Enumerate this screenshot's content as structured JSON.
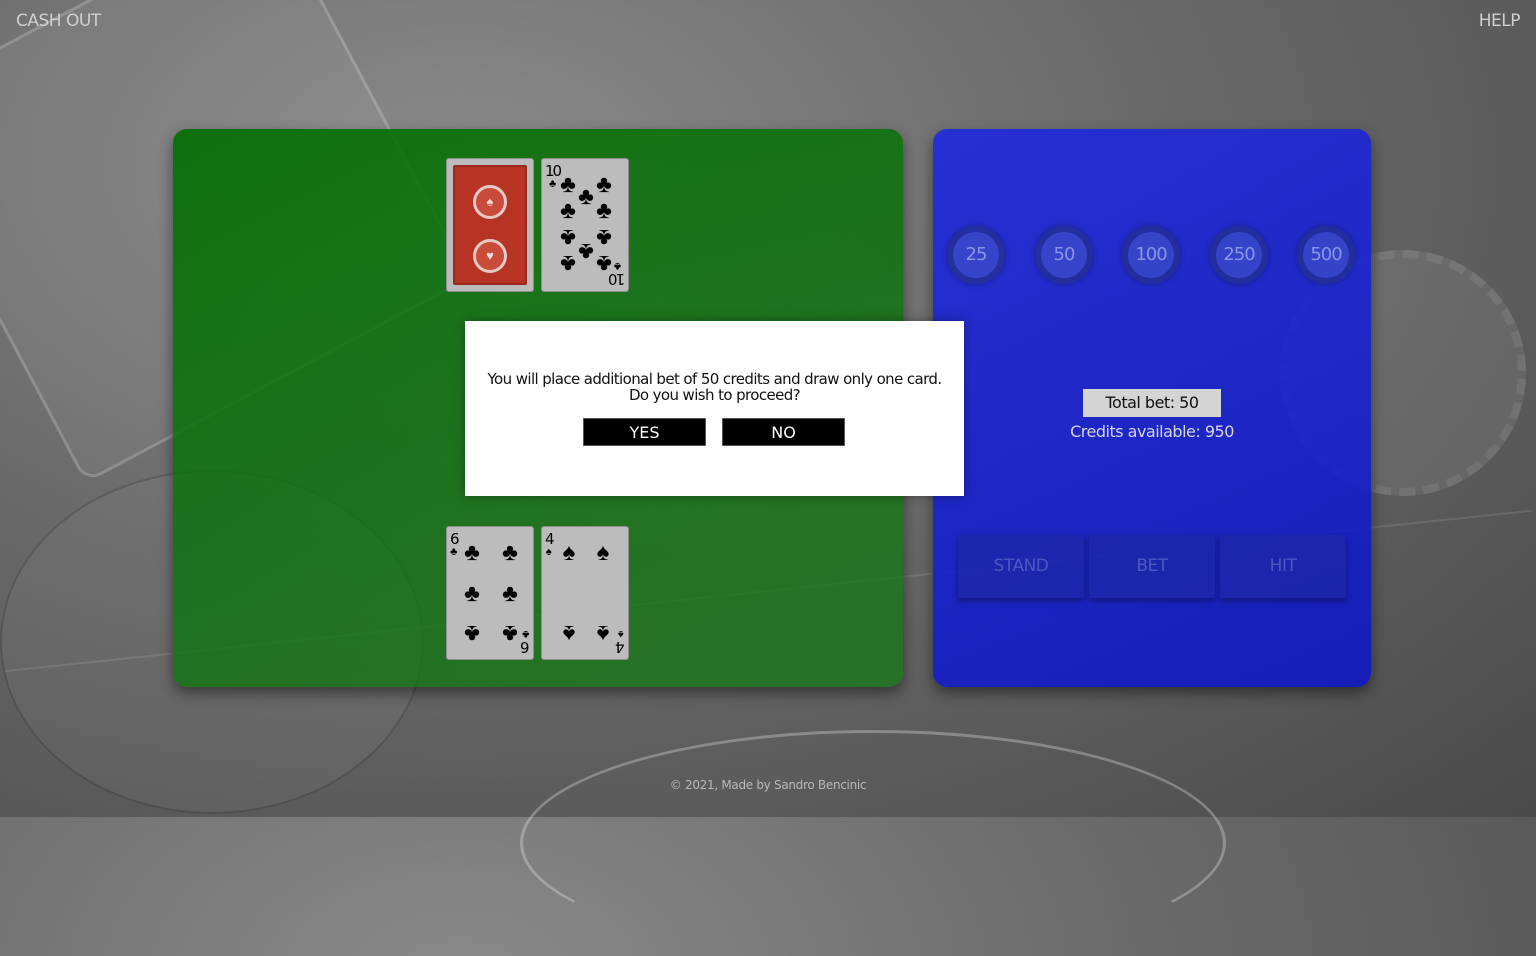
{
  "nav": {
    "cash_out": "CASH OUT",
    "help": "HELP"
  },
  "dealer_hand": [
    {
      "face_down": true
    },
    {
      "rank": "10",
      "suit": "♣"
    }
  ],
  "player_hand": [
    {
      "rank": "6",
      "suit": "♣"
    },
    {
      "rank": "4",
      "suit": "♠"
    }
  ],
  "chips": [
    "25",
    "50",
    "100",
    "250",
    "500"
  ],
  "bet": {
    "total_label": "Total bet: 50",
    "credits_label": "Credits available: 950"
  },
  "actions": {
    "stand": "STAND",
    "bet": "BET",
    "hit": "HIT"
  },
  "dialog": {
    "message": "You will place additional bet of 50 credits and draw only one card. Do you wish to proceed?",
    "yes": "YES",
    "no": "NO"
  },
  "footer": "© 2021, Made by Sandro Bencinic",
  "colors": {
    "table": "#0a7a0a",
    "controls": "#1a22d8",
    "card_back": "#b73323"
  }
}
